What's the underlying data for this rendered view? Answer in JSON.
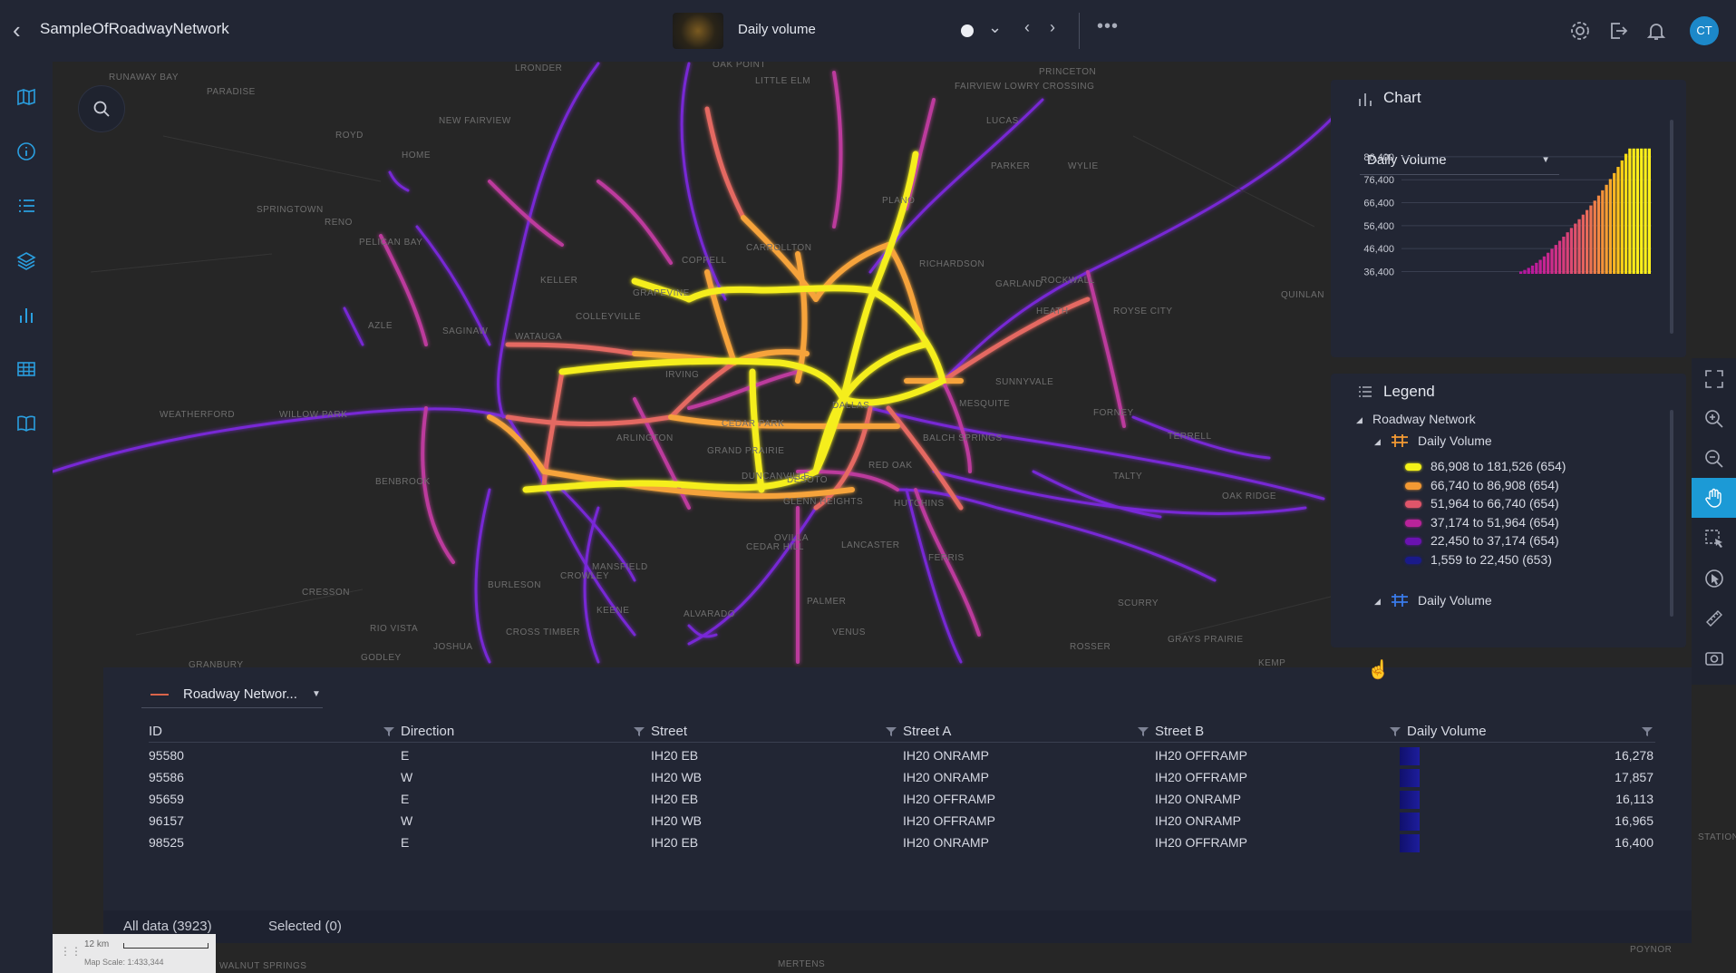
{
  "header": {
    "title": "SampleOfRoadwayNetwork",
    "layer_name": "Daily volume",
    "user_initials": "CT"
  },
  "map": {
    "labels": [
      "RUNAWAY BAY",
      "PARADISE",
      "ROYD",
      "HOME",
      "SPRINGTOWN",
      "RENO",
      "PELICAN BAY",
      "NEW FAIRVIEW",
      "LRONDER",
      "OAK POINT",
      "LITTLE ELM",
      "PRINCETON",
      "FAIRVIEW",
      "LOWRY CROSSING",
      "LUCAS",
      "PARKER",
      "WYLIE",
      "ROCKWALL",
      "QUINLAN",
      "ROYSE CITY",
      "HEATH",
      "SUNNYVALE",
      "MESQUITE",
      "FORNEY",
      "TERRELL",
      "TALTY",
      "OAK RIDGE",
      "SCURRY",
      "GRAYS PRAIRIE",
      "ROSSER",
      "KEMP",
      "HUTCHINS",
      "FERRIS",
      "PALMER",
      "RED OAK",
      "GLENN HEIGHTS",
      "OVILLA",
      "LANCASTER",
      "CEDAR HILL",
      "MANSFIELD",
      "CROWLEY",
      "BURLESON",
      "JOSHUA",
      "CROSS TIMBER",
      "GODLEY",
      "CRESSON",
      "GRANBURY",
      "BENBROOK",
      "WILLOW PARK",
      "WEATHERFORD",
      "AZLE",
      "SAGINAW",
      "WATAUGA",
      "KELLER",
      "COLLEYVILLE",
      "GRAPEVINE",
      "COPPELL",
      "CARROLLTON",
      "PLANO",
      "RICHARDSON",
      "GARLAND",
      "DALLAS",
      "IRVING",
      "ARLINGTON",
      "GRAND PRAIRIE",
      "DUNCANVILLE",
      "DESOTO",
      "BALCH SPRINGS",
      "CEDAR PARK",
      "VENUS",
      "ALVARADO",
      "RIO VISTA",
      "KEENE",
      "WALNUT SPRINGS",
      "MERTENS",
      "STATION",
      "POYNOR"
    ],
    "scale_distance": "12 km",
    "scale_text": "Map Scale: 1:433,344"
  },
  "chart_panel": {
    "title": "Chart",
    "dropdown": "Daily Volume"
  },
  "chart_data": {
    "type": "bar",
    "title": "",
    "ylabel": "",
    "xlabel": "",
    "ylim": [
      35400,
      91500
    ],
    "y_ticks": [
      86400,
      76400,
      66400,
      56400,
      46400,
      36400
    ],
    "y_tick_labels": [
      "86,400",
      "76,400",
      "66,400",
      "56,400",
      "46,400",
      "36,400"
    ],
    "values": [
      36400,
      37100,
      38000,
      39000,
      40200,
      41500,
      43000,
      44600,
      46300,
      48000,
      49800,
      51600,
      53500,
      55400,
      57300,
      59200,
      61200,
      63200,
      65200,
      67300,
      69500,
      71800,
      74200,
      76700,
      79300,
      82000,
      84800,
      87700,
      90000,
      90000,
      90000,
      90000,
      90000,
      90000
    ],
    "colors": [
      "#b5179e",
      "#b5179e",
      "#b8189e",
      "#bc1a9c",
      "#c01d9a",
      "#c42096",
      "#c72493",
      "#ca288f",
      "#cd2c8b",
      "#d03087",
      "#d33682",
      "#d73c7d",
      "#da4278",
      "#dd4a72",
      "#e0526c",
      "#e35a66",
      "#e66260",
      "#e96b59",
      "#ec7452",
      "#ef7e4a",
      "#f28842",
      "#f5933a",
      "#f79e32",
      "#f9aa2a",
      "#fbb622",
      "#fcc21c",
      "#fdd017",
      "#fedd15",
      "#ffe816",
      "#ffed18",
      "#fff01a",
      "#fff01a",
      "#fff01a",
      "#fff01a"
    ]
  },
  "legend_panel": {
    "title": "Legend",
    "group": "Roadway Network",
    "layers": [
      {
        "name": "Daily Volume",
        "items": [
          {
            "label": "86,908 to 181,526 (654)",
            "color": "#f5f218"
          },
          {
            "label": "66,740 to 86,908 (654)",
            "color": "#f49a33"
          },
          {
            "label": "51,964 to 66,740 (654)",
            "color": "#e0556a"
          },
          {
            "label": "37,174 to 51,964 (654)",
            "color": "#b9239a"
          },
          {
            "label": "22,450 to 37,174 (654)",
            "color": "#6a12b0"
          },
          {
            "label": "1,559 to 22,450 (653)",
            "color": "#1a1a8a"
          }
        ]
      },
      {
        "name": "Daily Volume"
      }
    ]
  },
  "table": {
    "layer_select": "Roadway Networ...",
    "columns": [
      "ID",
      "Direction",
      "Street",
      "Street A",
      "Street B",
      "Daily Volume"
    ],
    "rows": [
      [
        "95580",
        "E",
        "IH20 EB",
        "IH20 ONRAMP",
        "IH20 OFFRAMP",
        "16,278"
      ],
      [
        "95586",
        "W",
        "IH20 WB",
        "IH20 ONRAMP",
        "IH20 OFFRAMP",
        "17,857"
      ],
      [
        "95659",
        "E",
        "IH20 EB",
        "IH20 OFFRAMP",
        "IH20 ONRAMP",
        "16,113"
      ],
      [
        "96157",
        "W",
        "IH20 WB",
        "IH20 OFFRAMP",
        "IH20 ONRAMP",
        "16,965"
      ],
      [
        "98525",
        "E",
        "IH20 EB",
        "IH20 ONRAMP",
        "IH20 OFFRAMP",
        "16,400"
      ]
    ],
    "footer_all": "All data (3923)",
    "footer_selected": "Selected (0)"
  }
}
